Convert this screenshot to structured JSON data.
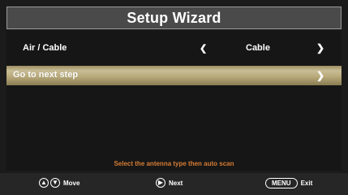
{
  "title": "Setup Wizard",
  "air_cable": {
    "label": "Air / Cable",
    "value": "Cable",
    "left_icon": "chevron-left-icon",
    "right_icon": "chevron-right-icon"
  },
  "next_step": {
    "label": "Go to next step",
    "right_icon": "chevron-right-icon"
  },
  "hint": "Select the antenna type then auto scan",
  "footer": {
    "move_label": "Move",
    "next_label": "Next",
    "menu_key": "MENU",
    "exit_label": "Exit"
  },
  "colors": {
    "highlight_gradient": [
      "#9d8f62",
      "#c8bd95",
      "#b9aa7b",
      "#897c52"
    ],
    "hint_orange": "#d77c34"
  }
}
